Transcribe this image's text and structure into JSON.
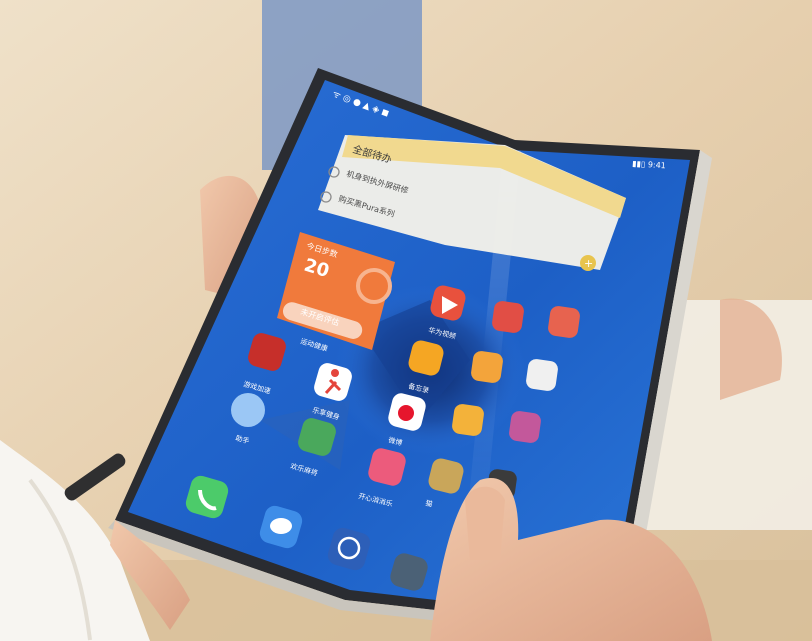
{
  "photo": {
    "subject": "foldable-phone",
    "colors": {
      "screen_blue": "#1f63c9",
      "phone_frame": "#2a2c31",
      "hinge_silver": "#d9d6cf",
      "widget_orange": "#f07a3c",
      "widget_yellow": "#f4e3a1",
      "background_warm": "#e8d8bf",
      "skin": "#e9b99b"
    }
  },
  "status_bar": {
    "left": "ᯤ ◎ ● ▲ ◈ ◼",
    "right": "▮▮▯ 9:41"
  },
  "todo_widget": {
    "title": "全部待办",
    "items": [
      {
        "label": "机身到执外屏研修"
      },
      {
        "label": "购买黑Pura系列"
      }
    ]
  },
  "steps_widget": {
    "title": "今日步数",
    "count": "20",
    "button": "未开启评估",
    "caption": "运动健康"
  },
  "apps": [
    {
      "name": "app-game",
      "label": "游戏加速",
      "icon": "game-icon"
    },
    {
      "name": "app-video",
      "label": "华为视频",
      "icon": "play-icon"
    },
    {
      "name": "app-sports",
      "label": "乐享健身",
      "icon": "runner-icon"
    },
    {
      "name": "app-notes",
      "label": "备忘录",
      "icon": "pencil-icon"
    },
    {
      "name": "app-assistant",
      "label": "助手",
      "icon": "circle-icon"
    },
    {
      "name": "app-weibo",
      "label": "微博",
      "icon": "weibo-icon"
    },
    {
      "name": "app-mahjong",
      "label": "欢乐麻将",
      "icon": "tile-icon"
    },
    {
      "name": "app-joy",
      "label": "开心消消乐",
      "icon": "cartoon-icon"
    },
    {
      "name": "app-cat",
      "label": "猫",
      "icon": "cat-icon"
    }
  ],
  "dock": [
    {
      "name": "dock-phone",
      "icon": "phone-icon"
    },
    {
      "name": "dock-messages",
      "icon": "message-icon"
    },
    {
      "name": "dock-browser",
      "icon": "browser-icon"
    },
    {
      "name": "dock-camera",
      "icon": "camera-icon"
    }
  ]
}
